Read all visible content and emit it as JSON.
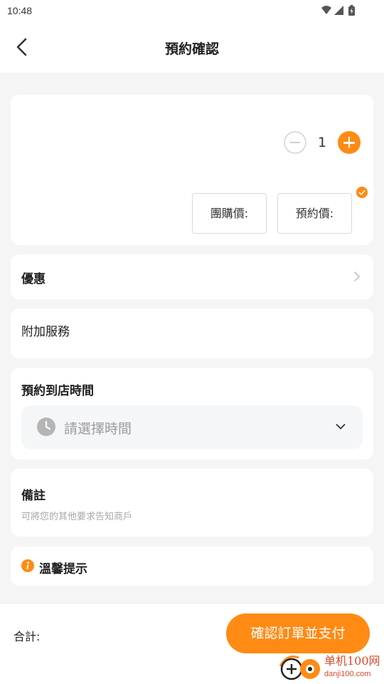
{
  "status_bar": {
    "time": "10:48"
  },
  "header": {
    "title": "預約確認"
  },
  "product": {
    "quantity": "1",
    "group_price_label": "團購價:",
    "reserve_price_label": "預約價:"
  },
  "discount": {
    "label": "優惠"
  },
  "addon": {
    "label": "附加服務"
  },
  "time": {
    "label": "預約到店時間",
    "placeholder": "請選擇時間"
  },
  "note": {
    "label": "備註",
    "placeholder": "可將您的其他要求告知商戶"
  },
  "tips": {
    "label": "溫馨提示"
  },
  "footer": {
    "total_label": "合計:",
    "pay_button": "確認訂單並支付"
  },
  "watermark": {
    "text": "单机100网",
    "sub": "danji100.com"
  },
  "colors": {
    "accent": "#ff8a14",
    "background": "#f5f5f5",
    "card": "#ffffff"
  },
  "icons": {
    "back": "chevron-left-icon",
    "minus": "minus-circle-icon",
    "plus": "plus-circle-icon",
    "check": "check-badge-icon",
    "arrow": "chevron-right-icon",
    "clock": "clock-icon",
    "dropdown": "chevron-down-icon",
    "info": "info-icon"
  }
}
